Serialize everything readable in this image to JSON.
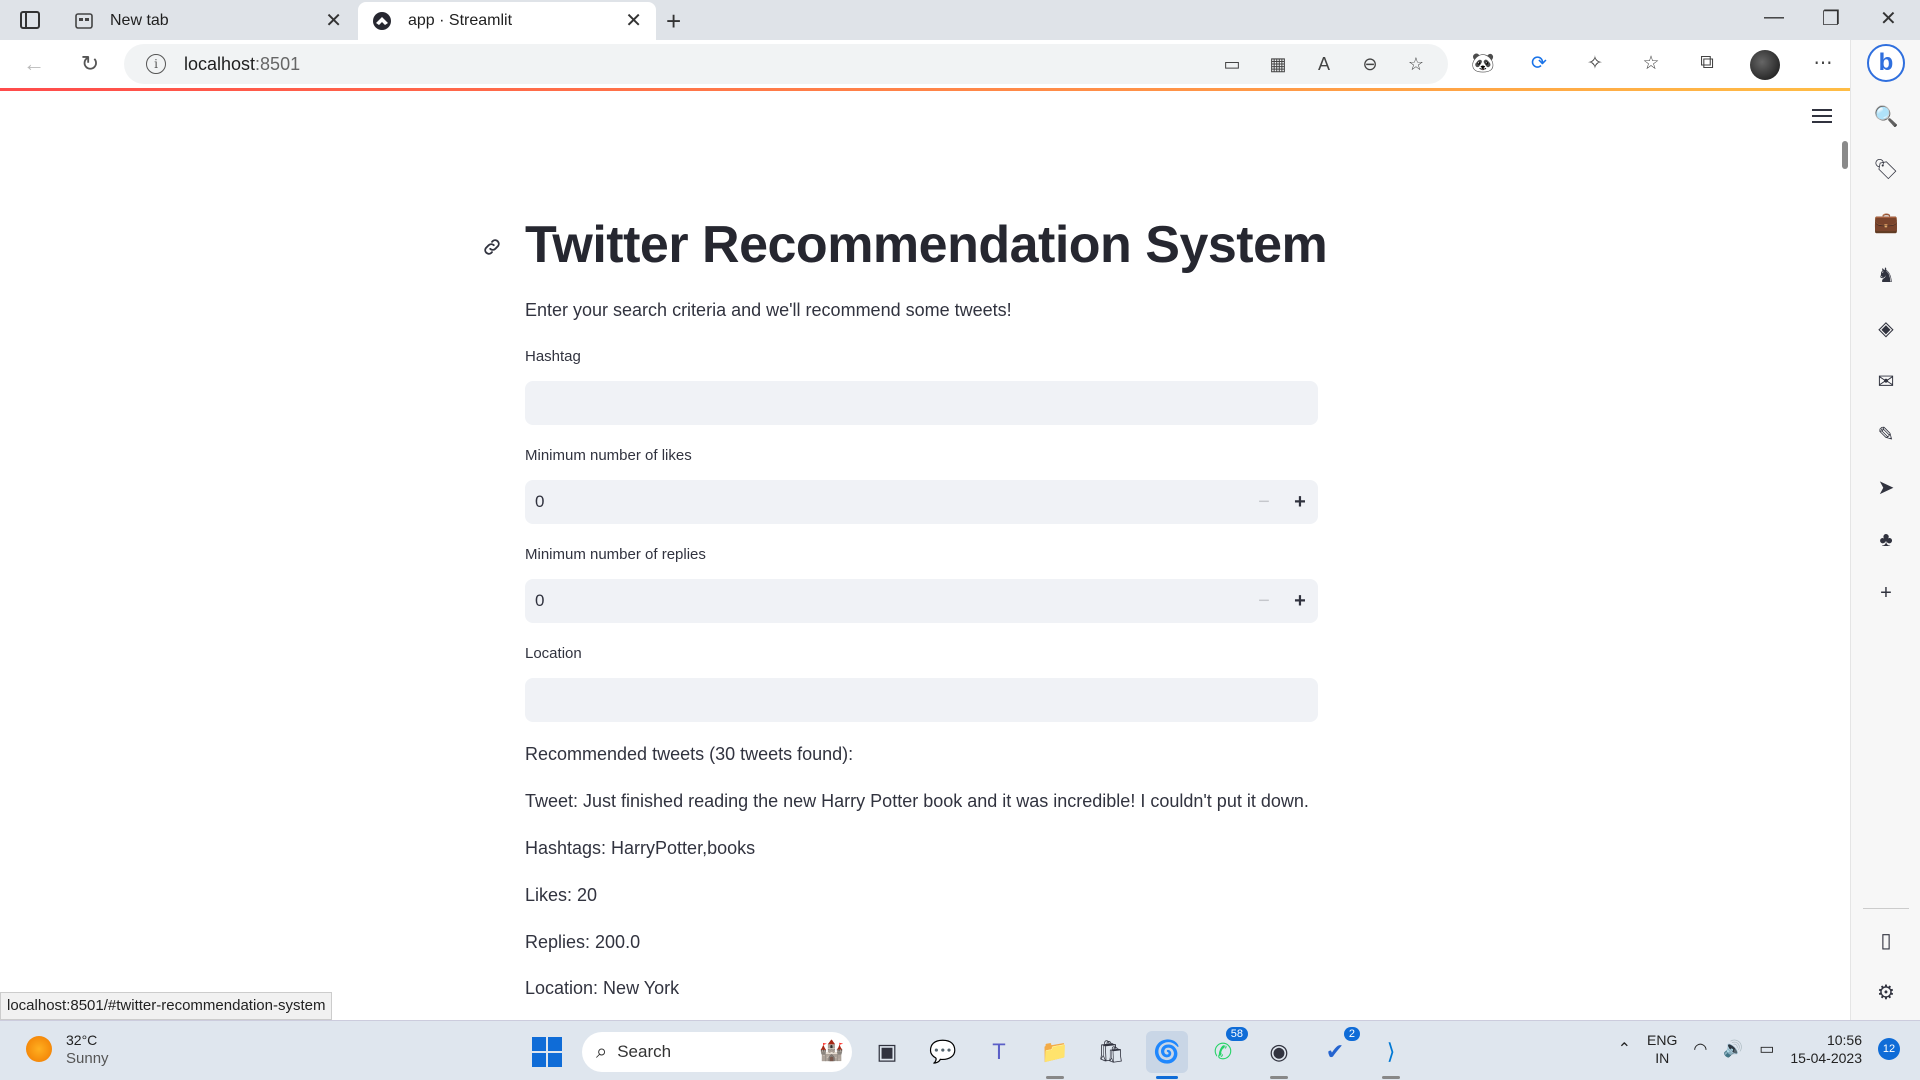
{
  "browser": {
    "tabs": [
      {
        "label": "New tab"
      },
      {
        "label": "app · Streamlit"
      }
    ],
    "new_tab_label": "+",
    "url_host": "localhost",
    "url_port": ":8501"
  },
  "app": {
    "title": "Twitter Recommendation System",
    "subtitle": "Enter your search criteria and we'll recommend some tweets!",
    "fields": {
      "hashtag": {
        "label": "Hashtag",
        "value": ""
      },
      "min_likes": {
        "label": "Minimum number of likes",
        "value": "0"
      },
      "min_replies": {
        "label": "Minimum number of replies",
        "value": "0"
      },
      "location": {
        "label": "Location",
        "value": ""
      }
    },
    "results_header": "Recommended tweets (30 tweets found):",
    "tweet": {
      "text": "Tweet: Just finished reading the new Harry Potter book and it was incredible! I couldn't put it down.",
      "hashtags": "Hashtags: HarryPotter,books",
      "likes": "Likes: 20",
      "replies": "Replies: 200.0",
      "location": "Location: New York"
    },
    "stepper": {
      "minus": "−",
      "plus": "+"
    }
  },
  "status_url": "localhost:8501/#twitter-recommendation-system",
  "taskbar": {
    "weather_temp": "32°C",
    "weather_desc": "Sunny",
    "search_label": "Search",
    "whatsapp_badge": "58",
    "todo_badge": "2",
    "lang_line1": "ENG",
    "lang_line2": "IN",
    "time": "10:56",
    "date": "15-04-2023",
    "notifications": "12"
  },
  "colors": {
    "streamlit_accent": "#ff4b4b",
    "input_bg": "#f0f2f6",
    "edge_blue": "#0f6cd7"
  }
}
